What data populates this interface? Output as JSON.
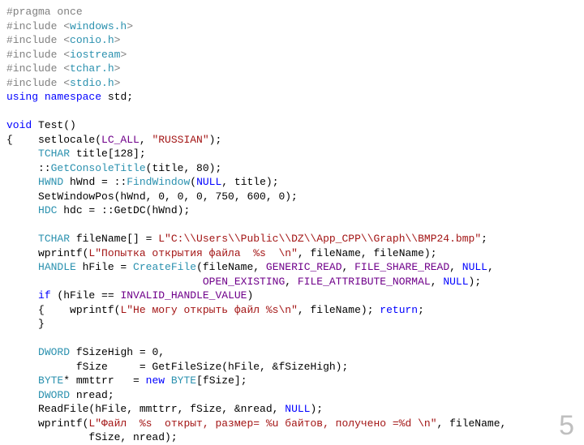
{
  "page_number": "5",
  "code": {
    "l01a": "#pragma once",
    "l02a": "#include <",
    "l02b": "windows.h",
    "l02c": ">",
    "l03a": "#include <",
    "l03b": "conio.h",
    "l03c": ">",
    "l04a": "#include <",
    "l04b": "iostream",
    "l04c": ">",
    "l05a": "#include <",
    "l05b": "tchar.h",
    "l05c": ">",
    "l06a": "#include <",
    "l06b": "stdio.h",
    "l06c": ">",
    "l07a": "using",
    "l07b": " ",
    "l07c": "namespace",
    "l07d": " std;",
    "l08": " ",
    "l09a": "void",
    "l09b": " Test()",
    "l10a": "{    setlocale(",
    "l10b": "LC_ALL",
    "l10c": ", ",
    "l10d": "\"RUSSIAN\"",
    "l10e": ");",
    "l11a": "     ",
    "l11b": "TCHAR",
    "l11c": " title[128];",
    "l12a": "     ::",
    "l12b": "GetConsoleTitle",
    "l12c": "(title, 80);",
    "l13a": "     ",
    "l13b": "HWND",
    "l13c": " hWnd = ::",
    "l13d": "FindWindow",
    "l13e": "(",
    "l13f": "NULL",
    "l13g": ", title);",
    "l14a": "     SetWindowPos(hWnd, 0, 0, 0, 750, 600, 0);",
    "l15a": "     ",
    "l15b": "HDC",
    "l15c": " hdc = ::GetDC(hWnd);",
    "l16": " ",
    "l17a": "     ",
    "l17b": "TCHAR",
    "l17c": " fileName[] = ",
    "l17d": "L\"C:\\\\Users\\\\Public\\\\DZ\\\\App_CPP\\\\Graph\\\\BMP24.bmp\"",
    "l17e": ";",
    "l18a": "     wprintf(",
    "l18b": "L\"Попытка открытия файла  %s  \\n\"",
    "l18c": ", fileName, fileName);",
    "l19a": "     ",
    "l19b": "HANDLE",
    "l19c": " hFile = ",
    "l19d": "CreateFile",
    "l19e": "(fileName, ",
    "l19f": "GENERIC_READ",
    "l19g": ", ",
    "l19h": "FILE_SHARE_READ",
    "l19i": ", ",
    "l19j": "NULL",
    "l19k": ",",
    "l20a": "                               ",
    "l20b": "OPEN_EXISTING",
    "l20c": ", ",
    "l20d": "FILE_ATTRIBUTE_NORMAL",
    "l20e": ", ",
    "l20f": "NULL",
    "l20g": ");",
    "l21a": "     ",
    "l21b": "if",
    "l21c": " (hFile == ",
    "l21d": "INVALID_HANDLE_VALUE",
    "l21e": ")",
    "l22a": "     {    wprintf(",
    "l22b": "L\"Не могу открыть файл %s\\n\"",
    "l22c": ", fileName); ",
    "l22d": "return",
    "l22e": ";",
    "l23a": "     }",
    "l24": " ",
    "l25a": "     ",
    "l25b": "DWORD",
    "l25c": " fSizeHigh = 0,",
    "l26a": "           fSize     = GetFileSize(hFile, &fSizeHigh);",
    "l27a": "     ",
    "l27b": "BYTE",
    "l27c": "* mmttrr   = ",
    "l27d": "new",
    "l27e": " ",
    "l27f": "BYTE",
    "l27g": "[fSize];",
    "l28a": "     ",
    "l28b": "DWORD",
    "l28c": " nread;",
    "l29a": "     ReadFile(hFile, mmttrr, fSize, &nread, ",
    "l29b": "NULL",
    "l29c": ");",
    "l30a": "     wprintf(",
    "l30b": "L\"Файл  %s  открыт, размер= %u байтов, получено =%d \\n\"",
    "l30c": ", fileName,",
    "l31a": "             fSize, nread);"
  }
}
